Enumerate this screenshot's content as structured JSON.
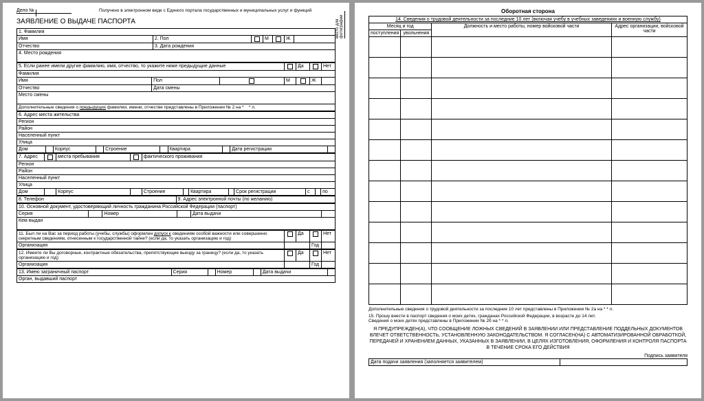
{
  "page1": {
    "dossier_label": "Дело №",
    "eportal_note": "Получено в электронном виде с Единого портала государственных и муниципальных услуг и функций",
    "vertical_note": "место для фотографии",
    "title": "ЗАЯВЛЕНИЕ О ВЫДАЧЕ ПАСПОРТА",
    "f1": "1. Фамилия",
    "f_name": "Имя",
    "f2": "2. Пол",
    "m": "М",
    "zh": "Ж",
    "otch": "Отчество",
    "f3": "3. Дата рождения",
    "f4": "4. Место рождения",
    "f5": "5. Если ранее имели другие фамилию, имя, отчество, то укажите ниже предыдущие данные",
    "yes": "Да",
    "no": "Нет",
    "fam": "Фамилия",
    "name2": "Имя",
    "pol": "Пол",
    "otch2": "Отчество",
    "date_change": "Дата смены",
    "place_change": "Место смены",
    "extra5": "Дополнительные сведения о предыдущих фамилии, имени, отчестве представлены в Приложении № 2 на *      * л.",
    "f6": "6. Адрес места жительства",
    "region": "Регион",
    "rayon": "Район",
    "np": "Населенный пункт",
    "street": "Улица",
    "house": "Дом",
    "korp": "Корпус",
    "stroenie": "Строение",
    "kv": "Квартира",
    "date_reg": "Дата регистрации",
    "f7": "7. Адрес",
    "stay": "места пребывания",
    "actual": "фактического проживания",
    "srok": "Срок регистрации",
    "s": "с",
    "po": "по",
    "f8": "8. Телефон",
    "f9": "9. Адрес электронной почты (по желанию)",
    "f10": "10. Основной документ, удостоверяющий личность гражданина Российской Федерации (паспорт)",
    "series": "Серия",
    "number": "Номер",
    "date_issue": "Дата выдачи",
    "issued_by": "Кем выдан",
    "f11": "11. Был ли на Вас за период работы (учебы, службы) оформлен допуск к сведениям особой важности или совершенно секретным сведениям, отнесенным к государственной тайне? (если да, то указать организацию и год)",
    "org": "Организация",
    "year": "Год",
    "f12": "12. Имеете ли Вы договорные, контрактные обязательства, препятствующие выезду за границу? (если да, то указать организацию и год)",
    "f13": "13. Имею заграничный паспорт",
    "organ": "Орган, выдавший паспорт"
  },
  "page2": {
    "title": "Оборотная сторона",
    "s14": "14. Сведения о трудовой деятельности за последние 10 лет (включая учебу в учебных заведениях и военную службу)",
    "col1": "Месяц и год",
    "col1a": "поступления",
    "col1b": "увольнения",
    "col2": "Должность и место работы, номер войсковой части",
    "col3": "Адрес организации, войсковой части",
    "extra14": "Дополнительные сведения о трудовой деятельности за последние 10 лет представлены  в Приложении № 2а на *         * л.",
    "s15": "15. Прошу внести в паспорт сведения о моих детях, гражданах Российской Федерации, в возрасте до 14 лет.",
    "s15b": "Сведения о моих детях представлены в Приложении № 2б на *      * л.",
    "warn": "Я ПРЕДУПРЕЖДЕН(А), ЧТО СООБЩЕНИЕ ЛОЖНЫХ СВЕДЕНИЙ В ЗАЯВЛЕНИИ ИЛИ ПРЕДСТАВЛЕНИЕ ПОДДЕЛЬНЫХ ДОКУМЕНТОВ ВЛЕЧЕТ ОТВЕТСТВЕННОСТЬ, УСТАНОВЛЕННУЮ ЗАКОНОДАТЕЛЬСТВОМ. Я СОГЛАСЕН(НА) С АВТОМАТИЗИРОВАННОЙ ОБРАБОТКОЙ, ПЕРЕДАЧЕЙ И ХРАНЕНИЕМ ДАННЫХ, УКАЗАННЫХ В ЗАЯВЛЕНИИ, В ЦЕЛЯХ ИЗГОТОВЛЕНИЯ, ОФОРМЛЕНИЯ И КОНТРОЛЯ ПАСПОРТА В ТЕЧЕНИЕ СРОКА ЕГО ДЕЙСТВИЯ",
    "sig": "Подпись заявителя",
    "date_sub": "Дата подачи заявления (заполняется заявителем)"
  }
}
